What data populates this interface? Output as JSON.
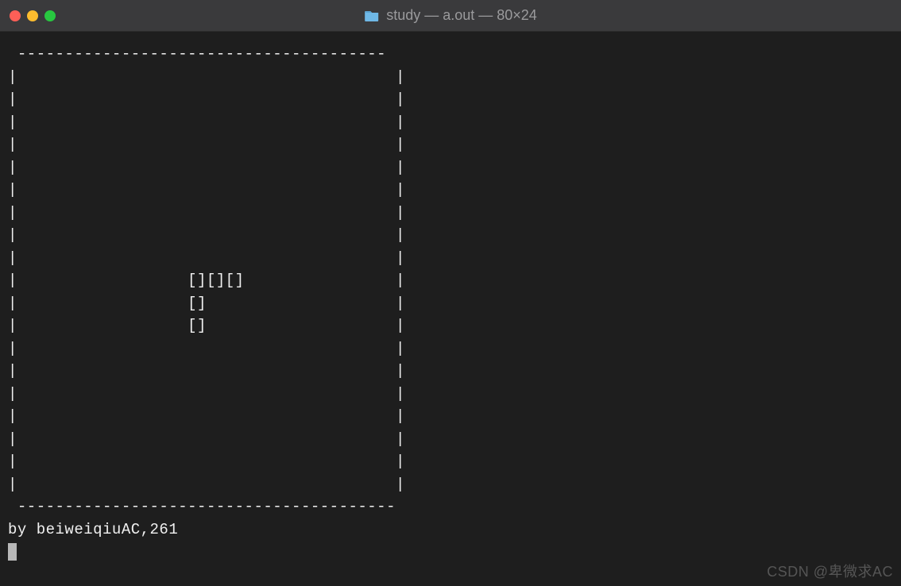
{
  "window": {
    "title": "study — a.out — 80×24"
  },
  "terminal": {
    "top_border": " ---------------------------------------",
    "row_empty": "|                                        |",
    "row_piece_1": "|                  [][][]                |",
    "row_piece_2": "|                  []                    |",
    "row_piece_3": "|                  []                    |",
    "bottom_border": " ----------------------------------------",
    "footer": "by beiweiqiuAC,261"
  },
  "watermark": "CSDN @卑微求AC"
}
